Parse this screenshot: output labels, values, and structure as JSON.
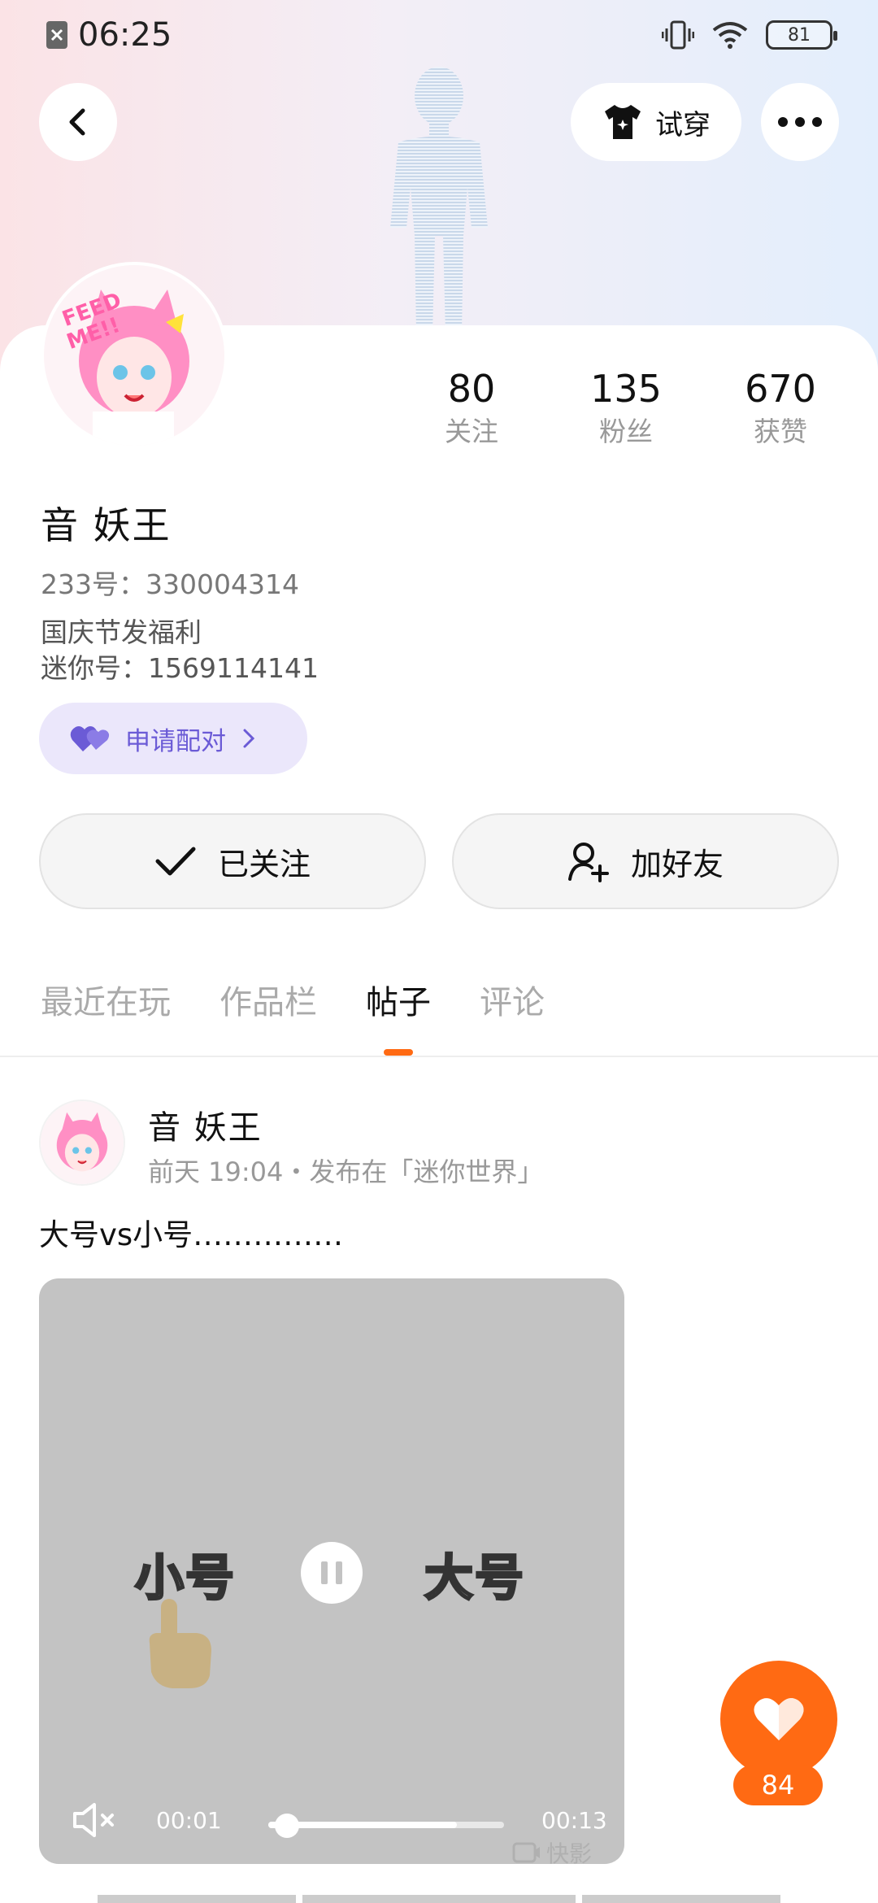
{
  "status_bar": {
    "time": "06:25",
    "battery": "81"
  },
  "header": {
    "try_on_label": "试穿"
  },
  "profile": {
    "stats": [
      {
        "value": "80",
        "label": "关注"
      },
      {
        "value": "135",
        "label": "粉丝"
      },
      {
        "value": "670",
        "label": "获赞"
      }
    ],
    "name": "音  妖王",
    "uid": "233号：330004314",
    "bio_line1": "国庆节发福利",
    "bio_line2": "迷你号：1569114141",
    "pair_label": "申请配对"
  },
  "actions": {
    "follow_label": "已关注",
    "add_friend_label": "加好友"
  },
  "tabs": [
    {
      "label": "最近在玩"
    },
    {
      "label": "作品栏"
    },
    {
      "label": "帖子"
    },
    {
      "label": "评论"
    }
  ],
  "post": {
    "author": "音  妖王",
    "meta": "前天 19:04・发布在「迷你世界」",
    "text": "大号vs小号……………",
    "video": {
      "label_left": "小号",
      "label_right": "大号",
      "current_time": "00:01",
      "duration": "00:13",
      "progress_fraction": 0.08,
      "buffered_fraction": 0.8,
      "watermark": "快影"
    }
  },
  "like": {
    "count": "84"
  },
  "colors": {
    "accent": "#ff6a13",
    "pair_purple": "#6b5bd6"
  }
}
